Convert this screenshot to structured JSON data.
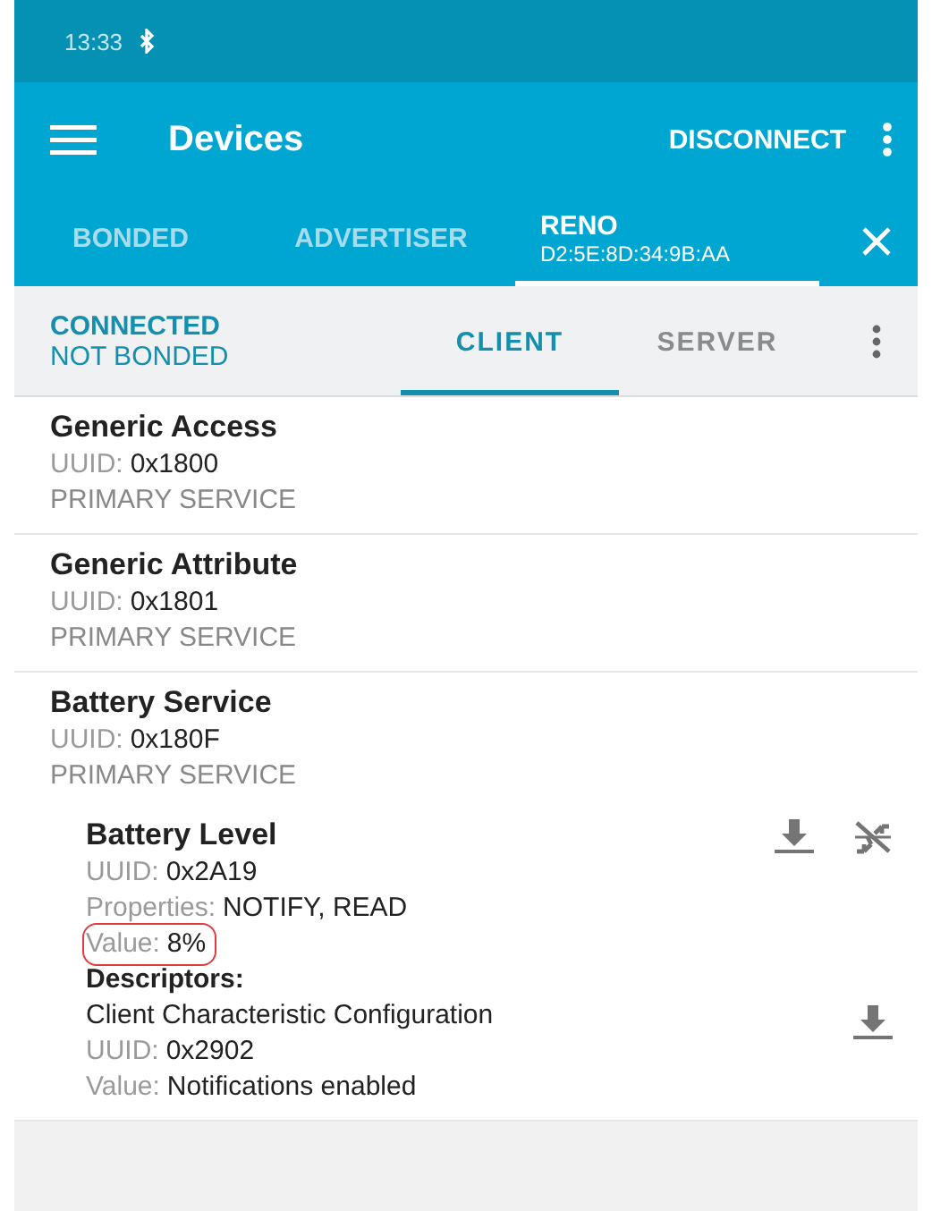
{
  "status_bar": {
    "time": "13:33"
  },
  "toolbar": {
    "title": "Devices",
    "action": "DISCONNECT"
  },
  "tabs": [
    {
      "label": "BONDED",
      "selected": false
    },
    {
      "label": "ADVERTISER",
      "selected": false
    },
    {
      "label": "RENO",
      "subtitle": "D2:5E:8D:34:9B:AA",
      "selected": true
    }
  ],
  "connection": {
    "state": "CONNECTED",
    "bond": "NOT BONDED"
  },
  "subtabs": [
    {
      "label": "CLIENT",
      "selected": true
    },
    {
      "label": "SERVER",
      "selected": false
    }
  ],
  "services": [
    {
      "name": "Generic Access",
      "fields": [
        {
          "label": "UUID:",
          "value": "0x1800"
        }
      ],
      "type": "PRIMARY SERVICE"
    },
    {
      "name": "Generic Attribute",
      "fields": [
        {
          "label": "UUID:",
          "value": "0x1801"
        }
      ],
      "type": "PRIMARY SERVICE"
    },
    {
      "name": "Battery Service",
      "fields": [
        {
          "label": "UUID:",
          "value": "0x180F"
        }
      ],
      "type": "PRIMARY SERVICE",
      "characteristics": [
        {
          "name": "Battery Level",
          "fields": [
            {
              "label": "UUID:",
              "value": "0x2A19",
              "highlighted": false
            },
            {
              "label": "Properties:",
              "value": "NOTIFY, READ",
              "highlighted": false
            },
            {
              "label": "Value:",
              "value": "8%",
              "highlighted": true
            }
          ],
          "descriptors_heading": "Descriptors:",
          "descriptors": [
            {
              "name": "Client Characteristic Configuration",
              "fields": [
                {
                  "label": "UUID:",
                  "value": "0x2902"
                },
                {
                  "label": "Value:",
                  "value": "Notifications enabled"
                }
              ]
            }
          ]
        }
      ]
    }
  ]
}
